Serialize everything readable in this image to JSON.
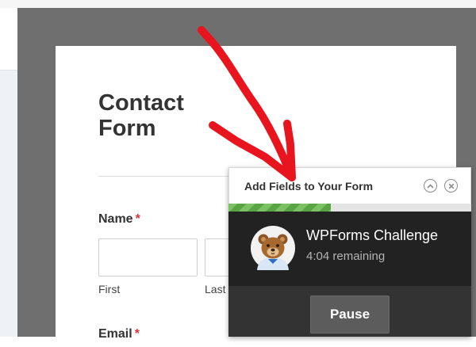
{
  "form": {
    "title": "Contact Form",
    "fields": [
      {
        "label": "Name",
        "required": "*",
        "sublabels": {
          "first": "First",
          "last": "Last"
        }
      },
      {
        "label": "Email",
        "required": "*"
      }
    ]
  },
  "challenge_popup": {
    "header_title": "Add Fields to Your Form",
    "collapse_icon": "chevron-up-icon",
    "close_icon": "close-icon",
    "progress": 0.42,
    "name": "WPForms Challenge",
    "time_remaining": "4:04 remaining",
    "pause_label": "Pause",
    "mascot_icon": "bear-mascot-icon"
  },
  "colors": {
    "arrow": "#e8141e",
    "required": "#d63638",
    "progress": "#6fb558",
    "popup_bg": "#2d2d2d"
  }
}
